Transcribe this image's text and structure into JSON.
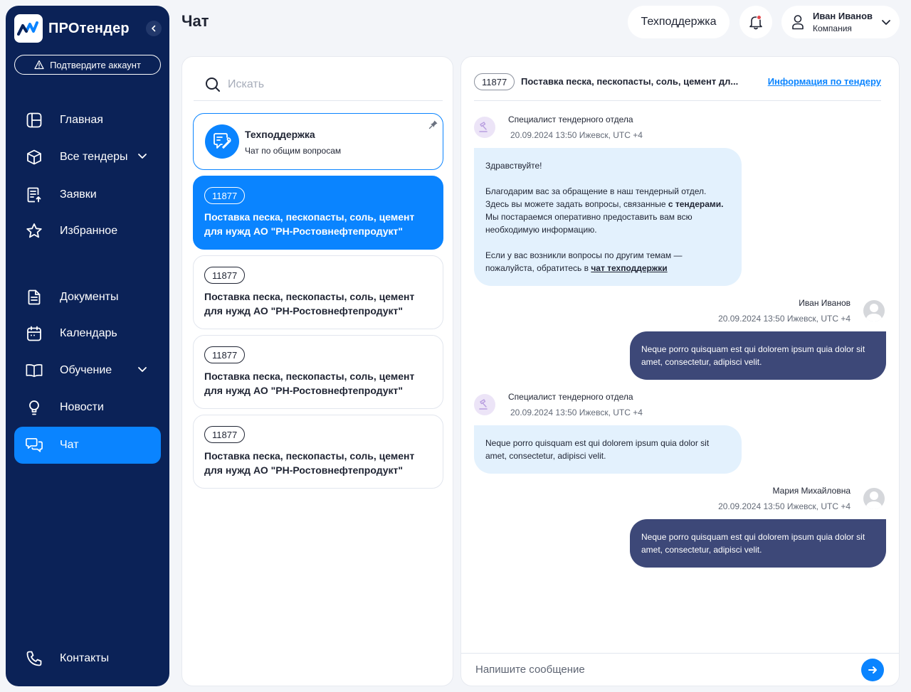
{
  "sidebar": {
    "logo_text": "ПРОтендер",
    "confirm_label": "Подтвердите аккаунт",
    "items": [
      {
        "label": "Главная"
      },
      {
        "label": "Все тендеры"
      },
      {
        "label": "Заявки"
      },
      {
        "label": "Избранное"
      },
      {
        "label": "Документы"
      },
      {
        "label": "Календарь"
      },
      {
        "label": "Обучение"
      },
      {
        "label": "Новости"
      },
      {
        "label": "Чат"
      },
      {
        "label": "Контакты"
      }
    ],
    "active_item": "Чат"
  },
  "header": {
    "title": "Чат",
    "support_label": "Техподдержка",
    "user_name": "Иван Иванов",
    "user_company": "Компания"
  },
  "list": {
    "search_placeholder": "Искать",
    "support_card": {
      "title": "Техподдержка",
      "subtitle": "Чат по общим вопросам"
    },
    "tenders": [
      {
        "id": "11877",
        "title": "Поставка песка, пескопасты, соль, цемент для нужд АО \"РН-Ростовнефтепродукт\""
      },
      {
        "id": "11877",
        "title": "Поставка песка, пескопасты, соль, цемент для нужд АО \"РН-Ростовнефтепродукт\""
      },
      {
        "id": "11877",
        "title": "Поставка песка, пескопасты, соль, цемент для нужд АО \"РН-Ростовнефтепродукт\""
      },
      {
        "id": "11877",
        "title": "Поставка песка, пескопасты, соль, цемент для нужд АО \"РН-Ростовнефтепродукт\""
      }
    ]
  },
  "chat": {
    "tender_id": "11877",
    "tender_title": "Поставка песка, пескопасты, соль, цемент дл...",
    "info_link": "Информация по тендеру",
    "messages": [
      {
        "sender": "Специалист тендерного отдела",
        "time": "20.09.2024 13:50 Ижевск, UTC +4",
        "p1": "Здравствуйте!",
        "p2a": "Благодарим вас за обращение в наш тендерный отдел. Здесь вы можете задать вопросы, связанные ",
        "p2b": "с тендерами.",
        "p2c": " Мы постараемся оперативно предоставить вам всю необходимую информацию.",
        "p3a": "Если у вас возникли вопросы по другим темам — пожалуйста, обратитесь в ",
        "p3b": "чат техподдержки"
      },
      {
        "sender": "Иван Иванов",
        "time": "20.09.2024 13:50 Ижевск, UTC +4",
        "text": "Neque porro quisquam est qui dolorem ipsum quia dolor sit amet, consectetur, adipisci velit."
      },
      {
        "sender": "Специалист тендерного отдела",
        "time": "20.09.2024 13:50 Ижевск, UTC +4",
        "text": "Neque porro quisquam est qui dolorem ipsum quia dolor sit amet, consectetur, adipisci velit."
      },
      {
        "sender": "Мария Михайловна",
        "time": "20.09.2024 13:50 Ижевск, UTC +4",
        "text": "Neque porro quisquam est qui dolorem ipsum quia dolor sit amet, consectetur, adipisci velit."
      }
    ],
    "composer_placeholder": "Напишите сообщение"
  },
  "colors": {
    "sidebar_bg": "#0b2257",
    "accent": "#0a84ff",
    "incoming_bubble": "#e3f1fd",
    "outgoing_bubble": "#3d4878"
  },
  "icons": [
    "logo-icon",
    "chevron-left-icon",
    "warning-icon",
    "dashboard-icon",
    "cube-icon",
    "application-icon",
    "star-icon",
    "document-icon",
    "calendar-icon",
    "book-icon",
    "lightbulb-icon",
    "chat-icon",
    "phone-icon",
    "bell-icon",
    "user-icon",
    "search-icon",
    "support-icon",
    "pin-icon",
    "send-icon"
  ]
}
